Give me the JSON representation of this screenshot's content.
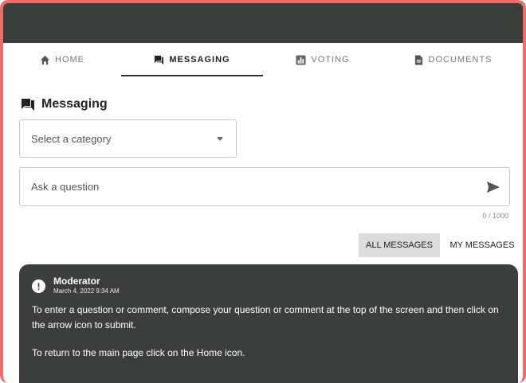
{
  "tabs": [
    {
      "label": "HOME",
      "icon": "home-icon"
    },
    {
      "label": "MESSAGING",
      "icon": "chat-icon"
    },
    {
      "label": "VOTING",
      "icon": "chart-icon"
    },
    {
      "label": "DOCUMENTS",
      "icon": "document-icon"
    }
  ],
  "section": {
    "title": "Messaging",
    "icon": "chat-icon"
  },
  "category_select": {
    "placeholder": "Select a category"
  },
  "question_input": {
    "placeholder": "Ask a question",
    "counter": "0 / 1000"
  },
  "message_filters": {
    "all": "ALL MESSAGES",
    "mine": "MY MESSAGES"
  },
  "message": {
    "author": "Moderator",
    "timestamp": "March 4, 2022 9:34 AM",
    "icon": "alert-icon",
    "paragraph1": "To enter a question or comment, compose your question or comment at the top of the screen and then click on the arrow icon to submit.",
    "paragraph2": "To return to the main page click on the Home icon."
  },
  "colors": {
    "header": "#3b3f3b",
    "frame": "#f26b6b",
    "active_filter": "#dcdcdc"
  }
}
